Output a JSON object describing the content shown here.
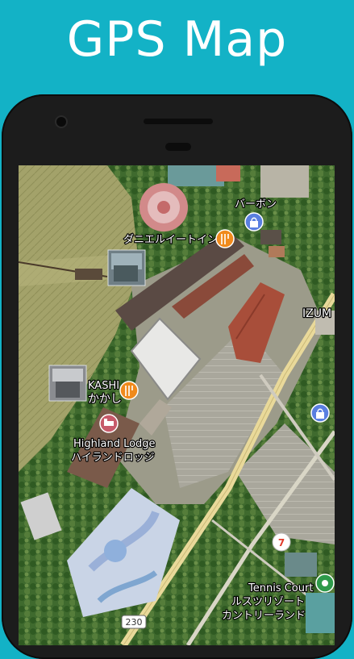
{
  "promo": {
    "title": "GPS Map"
  },
  "map": {
    "labels": {
      "restaurant": "ダニエルイートイン",
      "shop": "バーボン",
      "kashi_en": "KASHI",
      "kashi_jp": "かかし",
      "lodge_en": "Highland Lodge",
      "lodge_jp": "ハイランドロッジ",
      "izumi": "IZUM",
      "tennis_en": "Tennis Court",
      "tennis_jp1": "ルスツリゾート",
      "tennis_jp2": "カントリーランド",
      "route": "230"
    },
    "colors": {
      "food_marker": "#f08a1c",
      "shop_marker": "#5a7fe0",
      "hotel_marker": "#c75a6a",
      "park_marker": "#2e9a4a",
      "road": "#e9d99a"
    }
  }
}
